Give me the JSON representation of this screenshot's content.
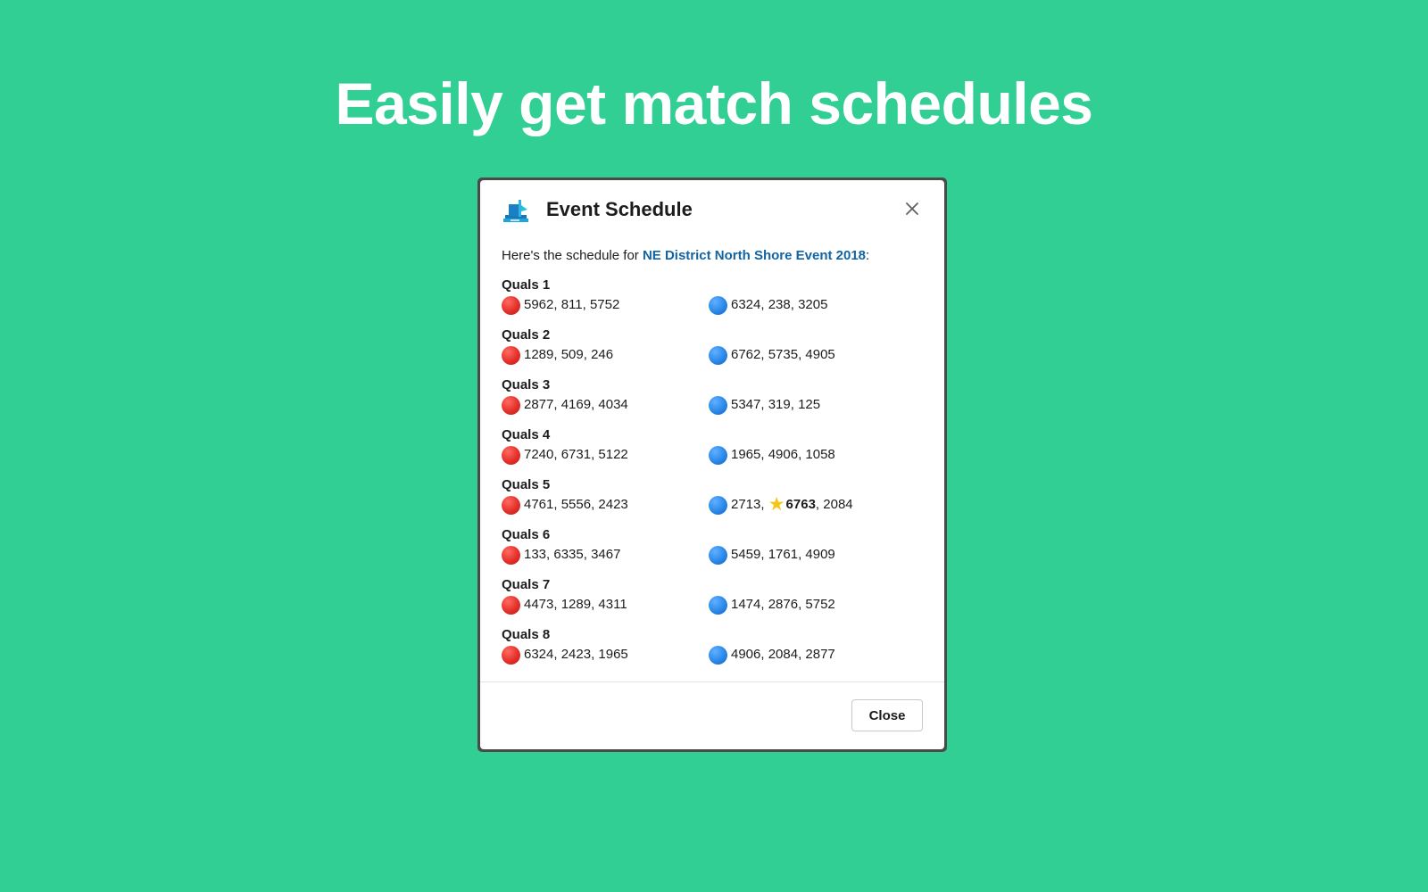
{
  "headline": "Easily get match schedules",
  "modal": {
    "title": "Event Schedule",
    "icon": "frc-robot-app-icon",
    "close_icon": "close-icon",
    "intro_prefix": "Here's the schedule for ",
    "event_link": "NE District North Shore Event 2018",
    "intro_suffix": ":",
    "close_button": "Close"
  },
  "colors": {
    "background": "#31cf94",
    "red_alliance": "#e3302a",
    "blue_alliance": "#2b88e8",
    "link": "#1264a3",
    "star": "#f5c518"
  },
  "matches": [
    {
      "title": "Quals 1",
      "red": "5962, 811, 5752",
      "blue": "6324, 238, 3205"
    },
    {
      "title": "Quals 2",
      "red": "1289, 509, 246",
      "blue": "6762, 5735, 4905"
    },
    {
      "title": "Quals 3",
      "red": "2877, 4169, 4034",
      "blue": "5347, 319, 125"
    },
    {
      "title": "Quals 4",
      "red": "7240, 6731, 5122",
      "blue": "1965, 4906, 1058"
    },
    {
      "title": "Quals 5",
      "red": "4761, 5556, 2423",
      "blue_parts": {
        "before": "2713, ",
        "highlight": "6763",
        "after": ", 2084"
      }
    },
    {
      "title": "Quals 6",
      "red": "133, 6335, 3467",
      "blue": "5459, 1761, 4909"
    },
    {
      "title": "Quals 7",
      "red": "4473, 1289, 4311",
      "blue": "1474, 2876, 5752"
    },
    {
      "title": "Quals 8",
      "red": "6324, 2423, 1965",
      "blue": "4906, 2084, 2877"
    }
  ]
}
